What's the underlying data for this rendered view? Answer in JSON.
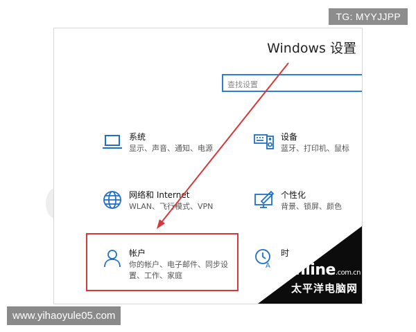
{
  "watermarks": {
    "tg": "TG: MYYJJPP",
    "site": "www.yihaoyule05.com"
  },
  "window": {
    "title": "Windows 设置"
  },
  "search": {
    "placeholder": "查找设置"
  },
  "categories": [
    {
      "name": "系统",
      "desc": "显示、声音、通知、电源",
      "icon": "laptop-icon"
    },
    {
      "name": "设备",
      "desc": "蓝牙、打印机、鼠标",
      "icon": "keyboard-speaker-icon"
    },
    {
      "name": "网络和 Internet",
      "desc": "WLAN、飞行模式、VPN",
      "icon": "globe-icon"
    },
    {
      "name": "个性化",
      "desc": "背景、锁屏、颜色",
      "icon": "paint-monitor-icon"
    },
    {
      "name": "帐户",
      "desc": "你的帐户、电子邮件、同步设置、工作、家庭",
      "icon": "person-icon"
    },
    {
      "name": "时",
      "desc": "",
      "icon": "clock-icon"
    }
  ],
  "colors": {
    "accent": "#1e6fc9",
    "highlight": "#d73737"
  },
  "brand": {
    "logo": "PConline",
    "domain": ".com.cn",
    "tagline": "太平洋电脑网"
  }
}
